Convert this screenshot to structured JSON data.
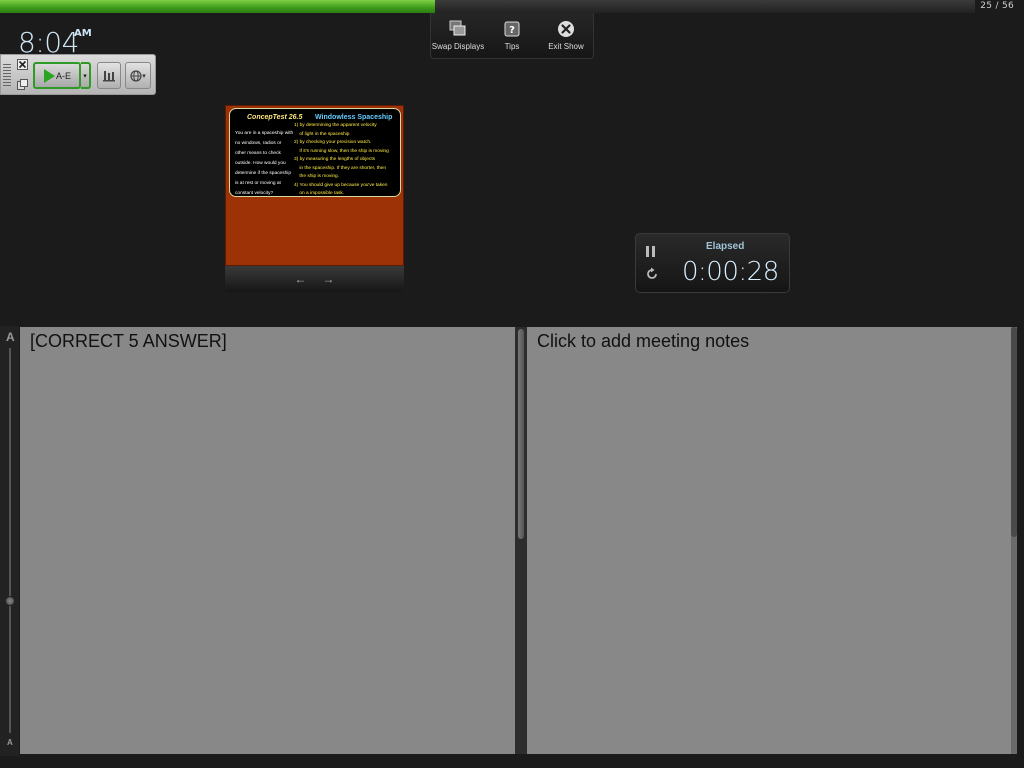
{
  "presentation": {
    "progress_text": "25 / 56",
    "progress_fraction": 0.425
  },
  "clock": {
    "time": "8:04",
    "ampm": "AM"
  },
  "top_toolbar": {
    "swap_displays_label": "Swap Displays",
    "tips_label": "Tips",
    "exit_show_label": "Exit Show"
  },
  "clicker": {
    "start_label": "A-E",
    "dropdown_glyph": "▾",
    "settings_glyph": "▾"
  },
  "slide": {
    "title": "ConcepTest 26.5",
    "subtitle": "Windowless Spaceship",
    "question_lines": [
      "You are in a spaceship with",
      "no windows, radios or",
      "other means to check",
      "outside.  How would you",
      "determine if the spaceship",
      "is at rest or moving at",
      "constant velocity?"
    ],
    "answer_lines": [
      "1) by determining the apparent velocity",
      "    of light in the spaceship",
      "2) by checking your precision watch.",
      "    If it's running slow, then the ship is moving",
      "3) by measuring the lengths of objects",
      "    in the spaceship.  If they are shorter, then",
      "    the ship is moving.",
      "4) You should give up because you've taken",
      "    on a impossible task."
    ],
    "prev_glyph": "←",
    "next_glyph": "→"
  },
  "timer": {
    "label": "Elapsed",
    "value": "0:00:28"
  },
  "font_slider": {
    "top_label": "A",
    "bottom_label": "A"
  },
  "notes": {
    "left_text": "[CORRECT 5 ANSWER]",
    "right_placeholder": "Click to add meeting notes"
  },
  "colors": {
    "progress_green": "#3c9a1a",
    "slide_background": "#9c3206",
    "notes_background": "#888888"
  }
}
